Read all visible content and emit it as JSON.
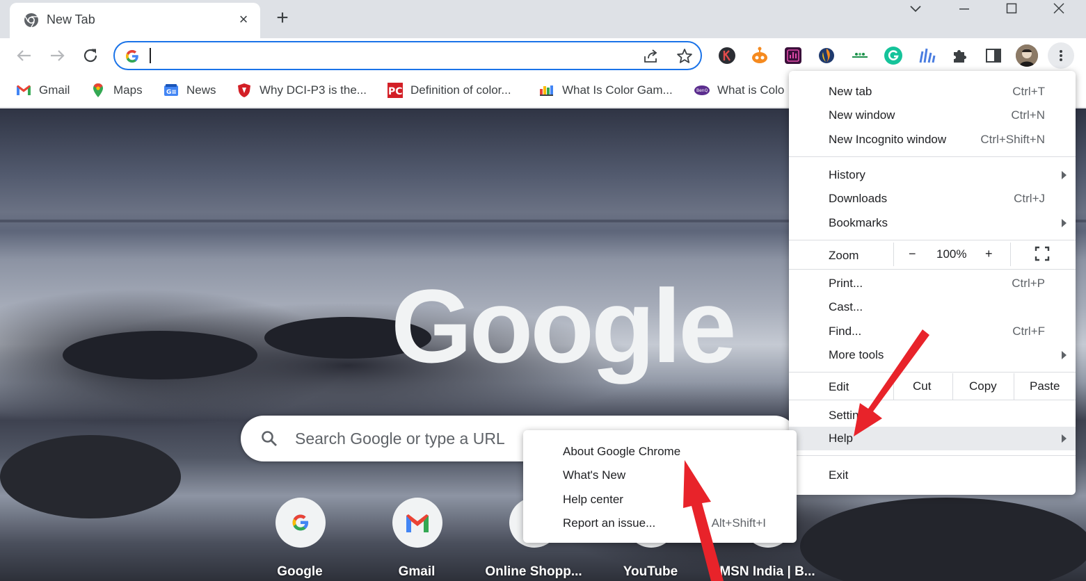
{
  "tab": {
    "title": "New Tab",
    "close": "×",
    "new_tab": "+"
  },
  "omnibox": {
    "value": ""
  },
  "bookmarks": [
    {
      "label": "Gmail",
      "icon": "gmail-icon"
    },
    {
      "label": "Maps",
      "icon": "maps-icon"
    },
    {
      "label": "News",
      "icon": "news-icon"
    },
    {
      "label": "Why DCI-P3 is the...",
      "icon": "shield-icon"
    },
    {
      "label": "Definition of color...",
      "icon": "pc-icon"
    },
    {
      "label": "What Is Color Gam...",
      "icon": "colors-icon"
    },
    {
      "label": "What is Colo",
      "icon": "benq-icon"
    }
  ],
  "ntp": {
    "logo": "Google",
    "search_placeholder": "Search Google or type a URL",
    "shortcuts": [
      {
        "label": "Google"
      },
      {
        "label": "Gmail"
      },
      {
        "label": "Online Shopp..."
      },
      {
        "label": "YouTube"
      },
      {
        "label": "MSN India | B..."
      }
    ]
  },
  "menu": {
    "new_tab": {
      "label": "New tab",
      "accel": "Ctrl+T"
    },
    "new_window": {
      "label": "New window",
      "accel": "Ctrl+N"
    },
    "new_incognito": {
      "label": "New Incognito window",
      "accel": "Ctrl+Shift+N"
    },
    "history": {
      "label": "History"
    },
    "downloads": {
      "label": "Downloads",
      "accel": "Ctrl+J"
    },
    "bookmarks": {
      "label": "Bookmarks"
    },
    "zoom": {
      "label": "Zoom",
      "minus": "−",
      "value": "100%",
      "plus": "+"
    },
    "print": {
      "label": "Print...",
      "accel": "Ctrl+P"
    },
    "cast": {
      "label": "Cast..."
    },
    "find": {
      "label": "Find...",
      "accel": "Ctrl+F"
    },
    "more_tools": {
      "label": "More tools"
    },
    "edit": {
      "label": "Edit",
      "cut": "Cut",
      "copy": "Copy",
      "paste": "Paste"
    },
    "settings": {
      "label": "Settings"
    },
    "help": {
      "label": "Help"
    },
    "exit": {
      "label": "Exit"
    }
  },
  "help_submenu": {
    "about": {
      "label": "About Google Chrome"
    },
    "whats_new": {
      "label": "What's New"
    },
    "help_center": {
      "label": "Help center"
    },
    "report": {
      "label": "Report an issue...",
      "accel": "Alt+Shift+I"
    }
  },
  "colors": {
    "accent": "#1a73e8",
    "annotation": "#e8232a"
  }
}
